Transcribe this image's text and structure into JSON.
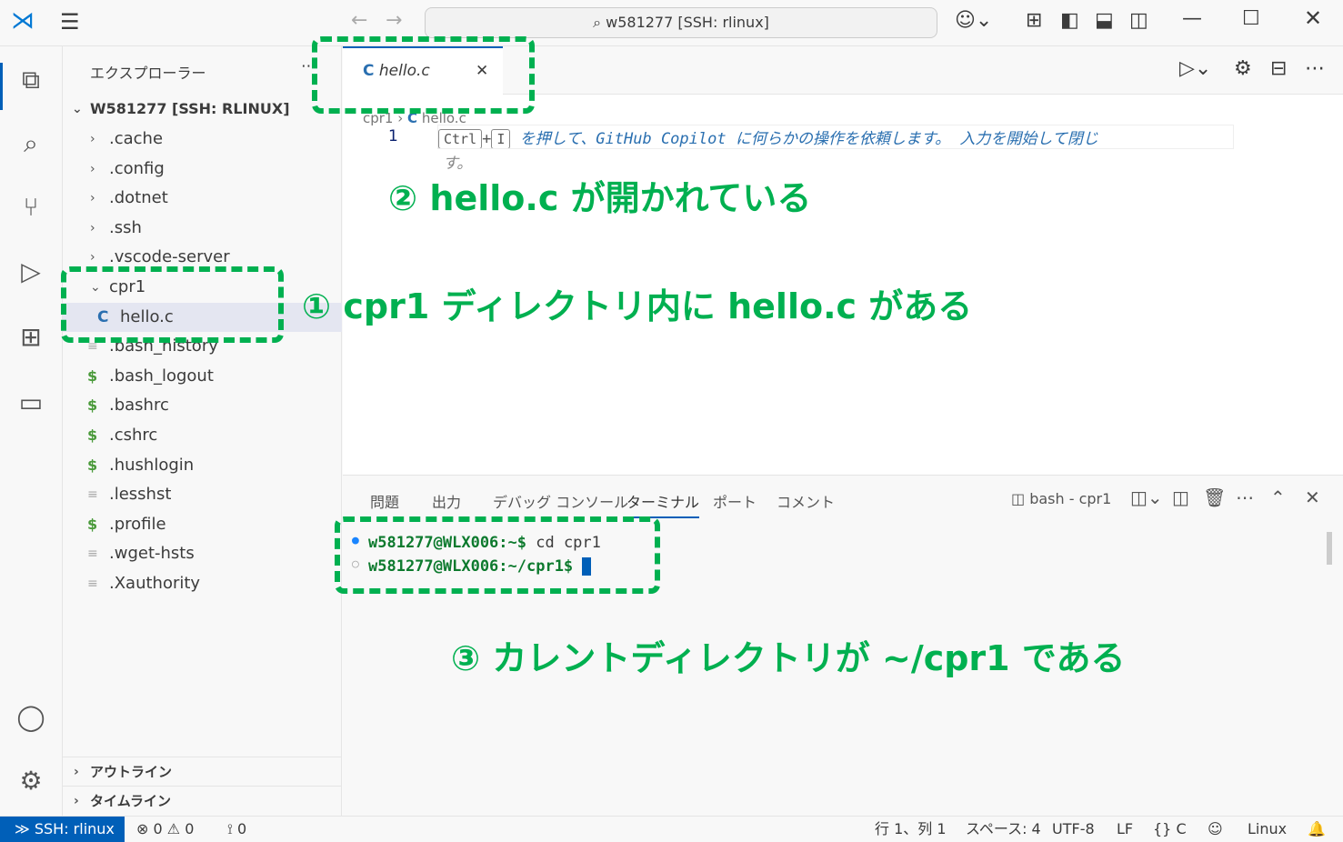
{
  "titlebar": {
    "search": "w581277 [SSH: rlinux]"
  },
  "sidebar": {
    "title": "エクスプローラー",
    "root": "W581277 [SSH: RLINUX]",
    "items": [
      ".cache",
      ".config",
      ".dotnet",
      ".ssh",
      ".vscode-server",
      "cpr1",
      "hello.c",
      ".bash_history",
      ".bash_logout",
      ".bashrc",
      ".cshrc",
      ".hushlogin",
      ".lesshst",
      ".profile",
      ".wget-hsts",
      ".Xauthority"
    ],
    "outline": "アウトライン",
    "timeline": "タイムライン"
  },
  "editor": {
    "tab": "hello.c",
    "breadcrumb": [
      "cpr1",
      "hello.c"
    ],
    "line_number": "1",
    "key1": "Ctrl",
    "plus": "+",
    "key2": "I",
    "hint": "を押して、GitHub Copilot に何らかの操作を依頼します。 入力を開始して閉じ",
    "hint_wrap": "す。"
  },
  "panel": {
    "tabs": [
      "問題",
      "出力",
      "デバッグ コンソール",
      "ターミナル",
      "ポート",
      "コメント"
    ],
    "active_tab": "ターミナル",
    "terminal_name": "bash - cpr1",
    "lines": [
      {
        "prompt": "w581277@WLX006:~$",
        "cmd": " cd cpr1"
      },
      {
        "prompt": "w581277@WLX006:~/cpr1$",
        "cmd": ""
      }
    ]
  },
  "status": {
    "remote": "SSH: rlinux",
    "errors": "0",
    "warnings": "0",
    "ports": "0",
    "position": "行 1、列 1",
    "spaces": "スペース: 4",
    "encoding": "UTF-8",
    "eol": "LF",
    "language": "C",
    "os": "Linux"
  },
  "annotations": {
    "a1": "① cpr1 ディレクトリ内に hello.c がある",
    "a2": "② hello.c が開かれている",
    "a3": "③ カレントディレクトリが ~/cpr1 である"
  },
  "colors": {
    "accent": "#005fb8",
    "annotation": "#00b050"
  }
}
